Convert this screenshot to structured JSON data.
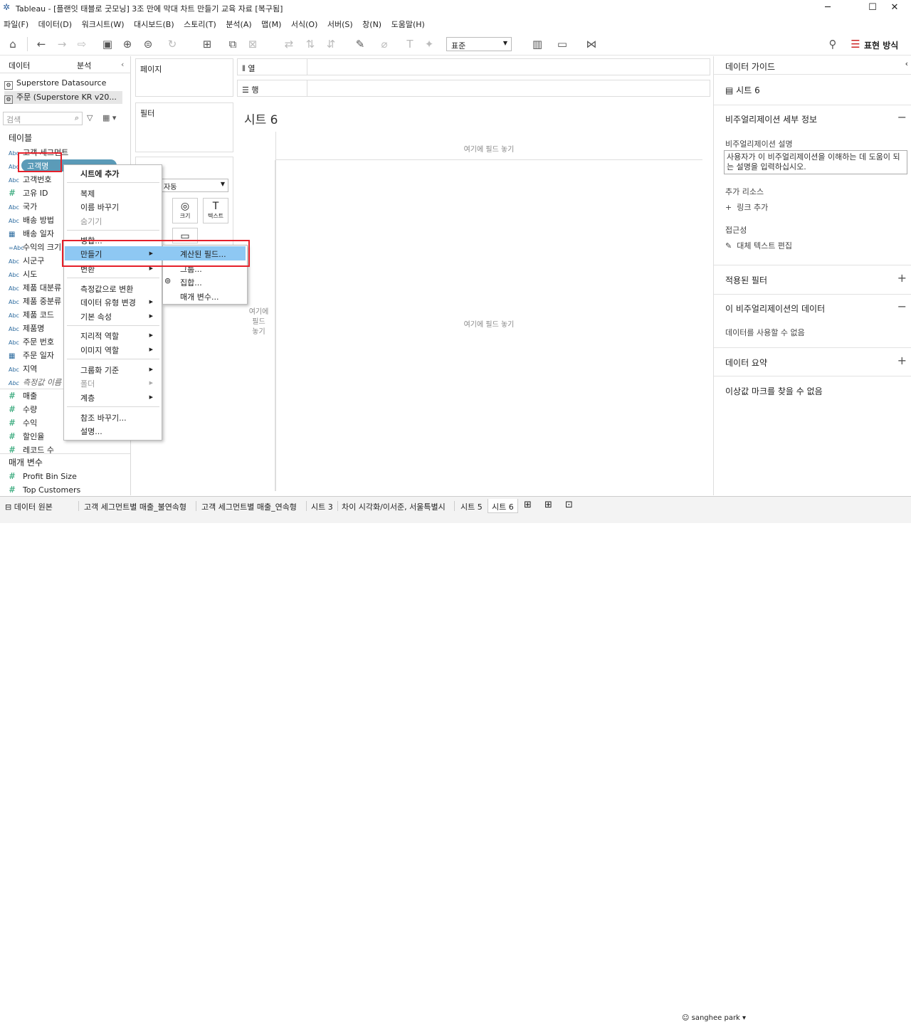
{
  "window": {
    "title": "Tableau - [플랜잇 태블로 굿모닝] 3조 만에 막대 차트 만들기 교육 자료 [복구됨]",
    "controls": [
      "─",
      "☐",
      "✕"
    ]
  },
  "menu": [
    "파일(F)",
    "데이터(D)",
    "워크시트(W)",
    "대시보드(B)",
    "스토리(T)",
    "분석(A)",
    "맵(M)",
    "서식(O)",
    "서버(S)",
    "창(N)",
    "도움말(H)"
  ],
  "toolbar": {
    "format_dropdown": "표준",
    "show_me": "표현 방식"
  },
  "left_pane": {
    "tabs": [
      "데이터",
      "분석"
    ],
    "datasources": [
      "Superstore Datasource",
      "주문 (Superstore KR v20..."
    ],
    "search_placeholder": "검색",
    "tables_header": "테이블",
    "fields": [
      {
        "type": "Abc",
        "name": "고객 세그먼트"
      },
      {
        "type": "Abc",
        "name": "고객명"
      },
      {
        "type": "Abc",
        "name": "고객번호"
      },
      {
        "type": "#",
        "name": "고유 ID"
      },
      {
        "type": "Abc",
        "name": "국가"
      },
      {
        "type": "Abc",
        "name": "배송 방법"
      },
      {
        "type": "cal",
        "name": "배송 일자"
      },
      {
        "type": "=Abc",
        "name": "수익의 크기"
      },
      {
        "type": "Abc",
        "name": "시군구"
      },
      {
        "type": "Abc",
        "name": "시도"
      },
      {
        "type": "Abc",
        "name": "제품 대분류"
      },
      {
        "type": "Abc",
        "name": "제품 중분류"
      },
      {
        "type": "Abc",
        "name": "제품 코드"
      },
      {
        "type": "Abc",
        "name": "제품명"
      },
      {
        "type": "Abc",
        "name": "주문 번호"
      },
      {
        "type": "cal",
        "name": "주문 일자"
      },
      {
        "type": "Abc",
        "name": "지역"
      },
      {
        "type": "Abc",
        "name": "측정값 이름"
      },
      {
        "type": "#",
        "name": "매출"
      },
      {
        "type": "#",
        "name": "수량"
      },
      {
        "type": "#",
        "name": "수익"
      },
      {
        "type": "#",
        "name": "할인율"
      },
      {
        "type": "#",
        "name": "레코드 수"
      }
    ],
    "params_header": "매개 변수",
    "params": [
      "Profit Bin Size",
      "Top Customers"
    ]
  },
  "shelves": {
    "pages": "페이지",
    "filters": "필터",
    "columns": "열",
    "rows": "행",
    "marks_dropdown": "자동",
    "mark_buttons": [
      "크기",
      "텍스트"
    ]
  },
  "sheet": {
    "title": "시트 6",
    "drop_hint": "여기에 필드 놓기",
    "drop_hint_left": "여기에\n필드\n놓기"
  },
  "context_menu": {
    "items": [
      {
        "label": "시트에 추가",
        "style": "bold"
      },
      {
        "label": "복제"
      },
      {
        "label": "이름 바꾸기"
      },
      {
        "label": "숨기기",
        "style": "disabled"
      },
      {
        "label": "병합..."
      },
      {
        "label": "만들기",
        "sub": true,
        "highlight": true
      },
      {
        "label": "변환",
        "sub": true
      },
      {
        "label": "측정값으로 변환"
      },
      {
        "label": "데이터 유형 변경",
        "sub": true
      },
      {
        "label": "기본 속성",
        "sub": true
      },
      {
        "label": "지리적 역할",
        "sub": true
      },
      {
        "label": "이미지 역할",
        "sub": true
      },
      {
        "label": "그룹화 기준",
        "sub": true
      },
      {
        "label": "폴더",
        "sub": true,
        "style": "disabled"
      },
      {
        "label": "계층",
        "sub": true
      },
      {
        "label": "참조 바꾸기..."
      },
      {
        "label": "설명..."
      }
    ],
    "submenu": [
      "계산된 필드...",
      "그룹...",
      "집합...",
      "매개 변수..."
    ]
  },
  "right_pane": {
    "header": "데이터 가이드",
    "sheet": "시트 6",
    "viz_details": "비주얼리제이션 세부 정보",
    "viz_desc_label": "비주얼리제이션 설명",
    "viz_desc_text": "사용자가 이 비주얼리제이션을 이해하는 데 도움이 되는 설명을 입력하십시오.",
    "extra_resources": "추가 리소스",
    "add_link": "링크 추가",
    "accessibility": "접근성",
    "alt_text": "대체 텍스트 편집",
    "applied_filters": "적용된 필터",
    "viz_data": "이 비주얼리제이션의 데이터",
    "data_unavailable": "데이터를 사용할 수 없음",
    "data_summary": "데이터 요약",
    "outliers": "이상값 마크를 찾을 수 없음"
  },
  "bottom_tabs": [
    "데이터 원본",
    "고객 세그먼트별 매출_불연속형",
    "고객 세그먼트별 매출_연속형",
    "시트 3",
    "차이 시각화/이서준, 서울특별시",
    "시트 5",
    "시트 6"
  ],
  "user": "sanghee park"
}
